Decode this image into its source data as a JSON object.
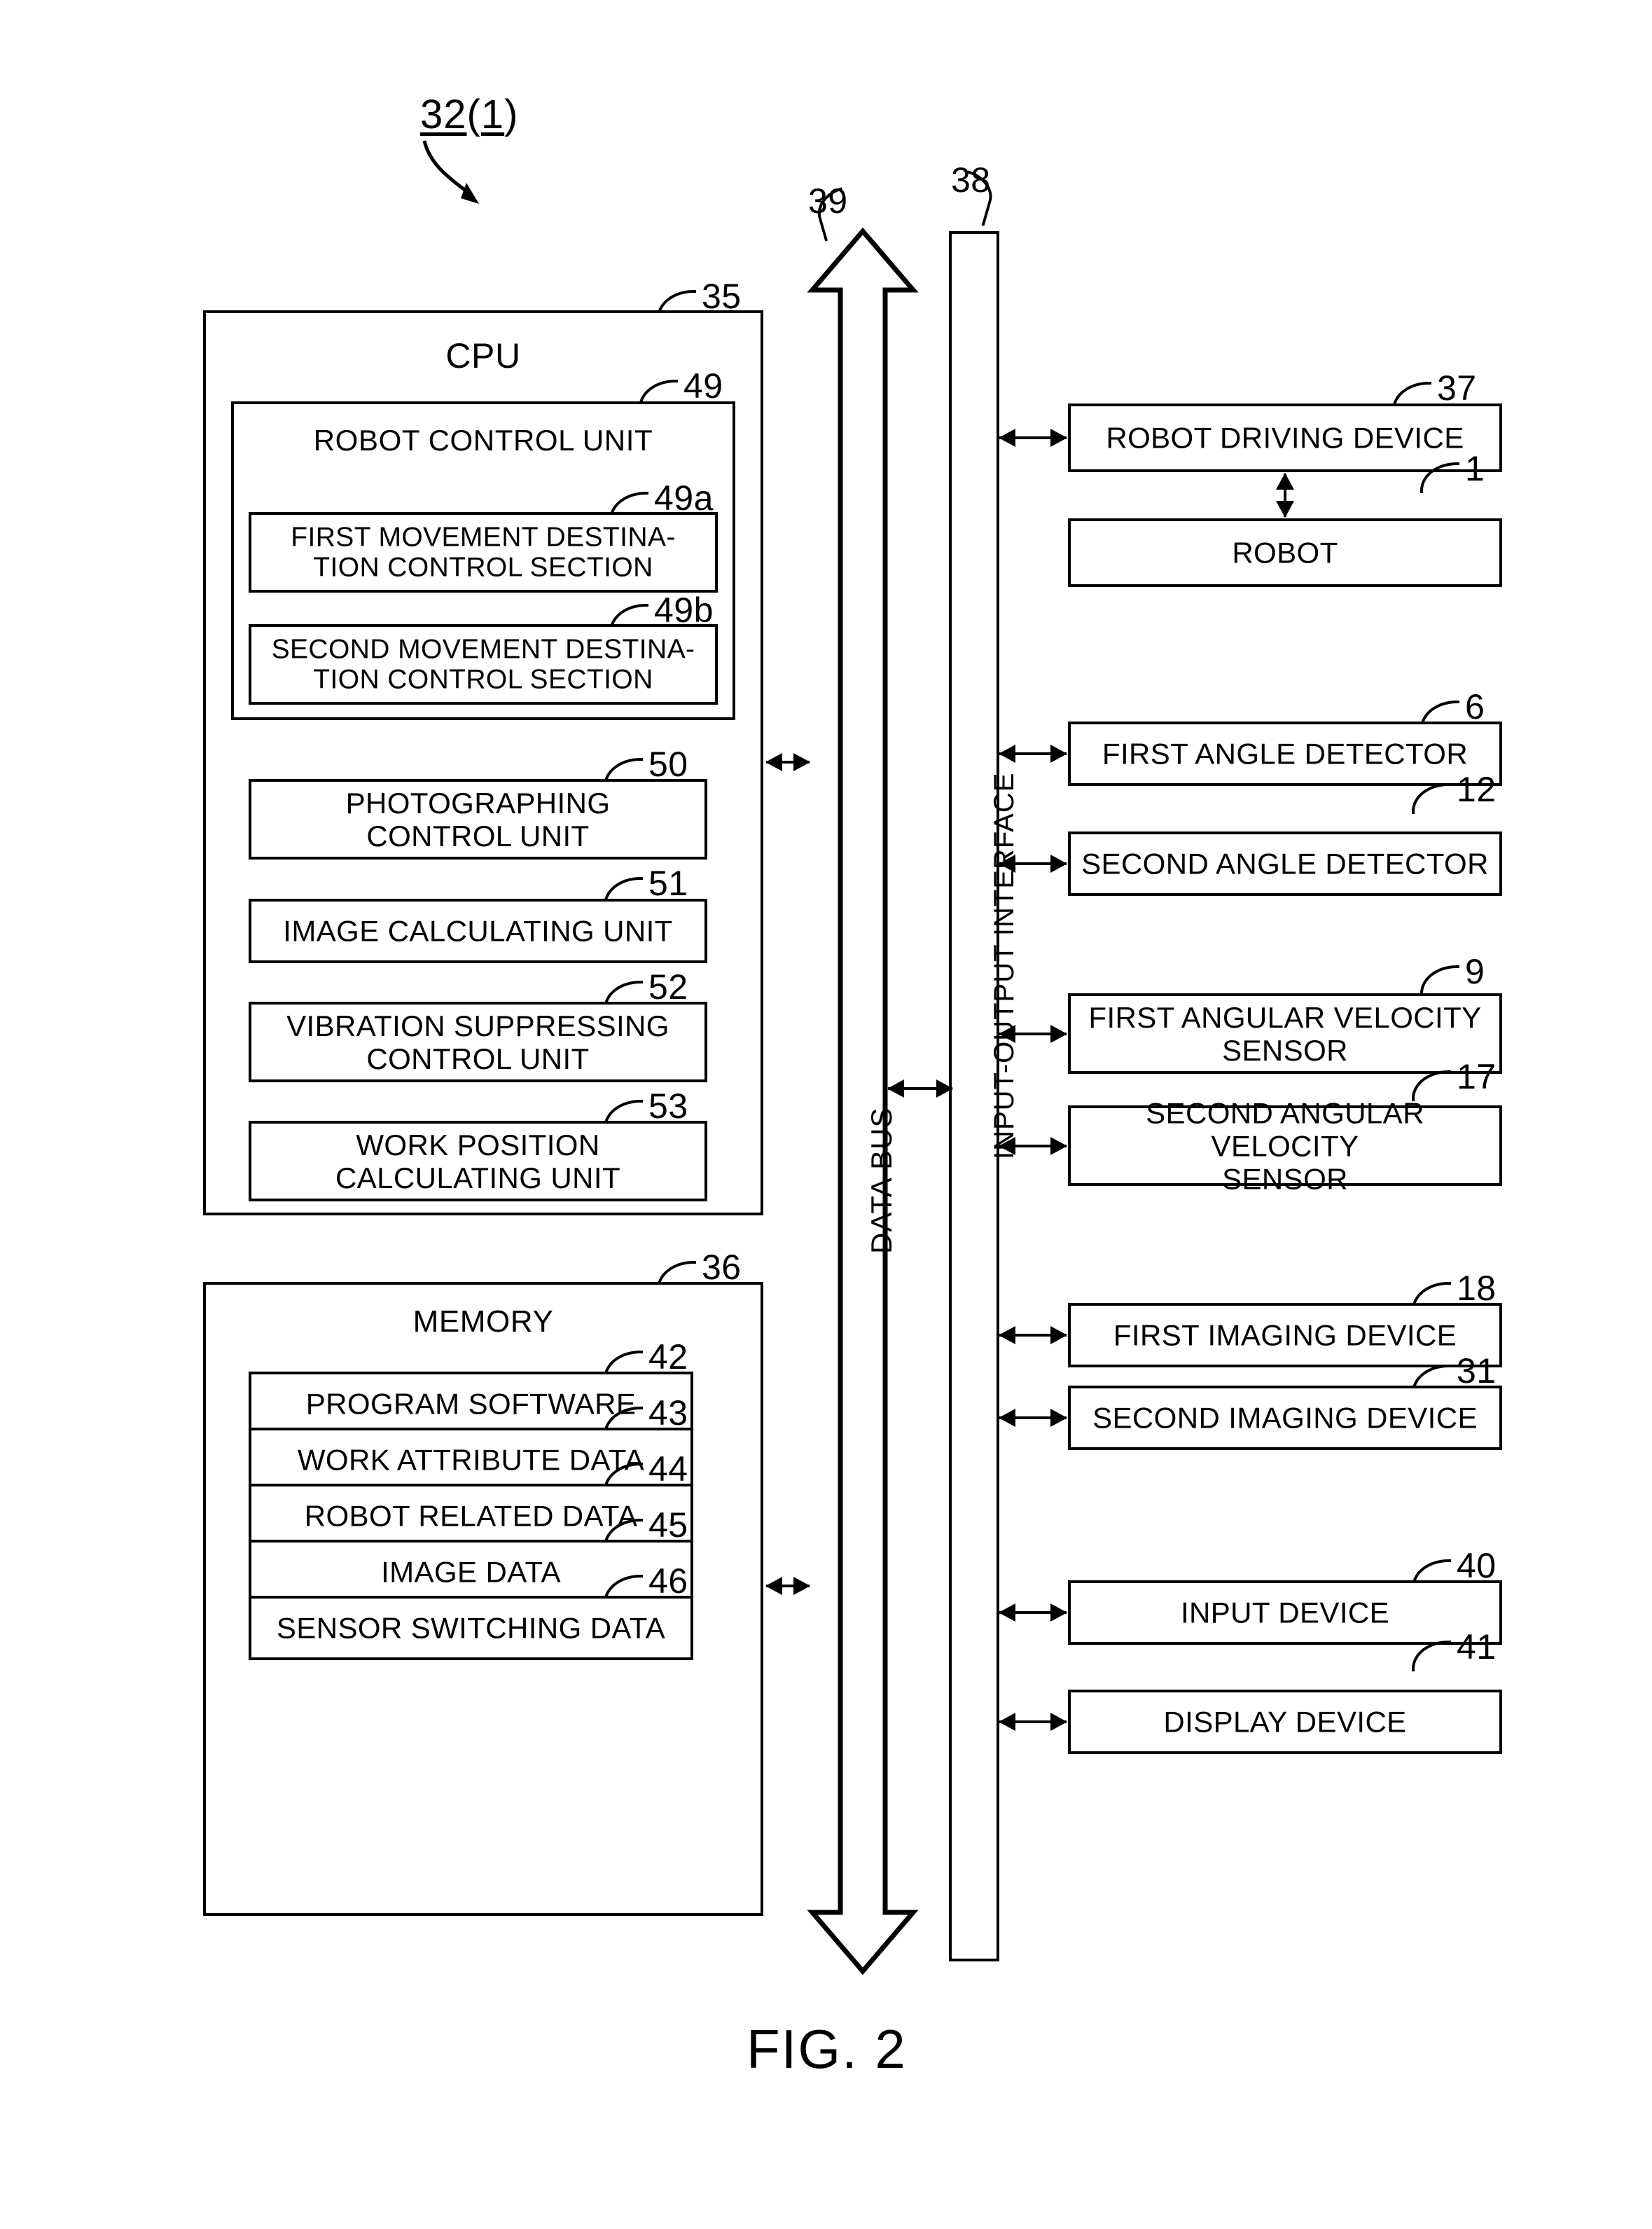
{
  "figure": {
    "caption": "FIG. 2"
  },
  "system_tag": {
    "main": "32",
    "paren_open": "(",
    "sub": "1",
    "paren_close": ")"
  },
  "controller": {
    "cpu": {
      "ref": "35",
      "title": "CPU",
      "robot_control_unit": {
        "ref": "49",
        "title": "ROBOT CONTROL UNIT",
        "sections": [
          {
            "ref": "49a",
            "line1": "FIRST MOVEMENT DESTINA-",
            "line2": "TION CONTROL SECTION"
          },
          {
            "ref": "49b",
            "line1": "SECOND MOVEMENT DESTINA-",
            "line2": "TION CONTROL SECTION"
          }
        ]
      },
      "units": [
        {
          "ref": "50",
          "line1": "PHOTOGRAPHING",
          "line2": "CONTROL UNIT"
        },
        {
          "ref": "51",
          "line1": "IMAGE CALCULATING UNIT",
          "line2": ""
        },
        {
          "ref": "52",
          "line1": "VIBRATION SUPPRESSING",
          "line2": "CONTROL UNIT"
        },
        {
          "ref": "53",
          "line1": "WORK POSITION",
          "line2": "CALCULATING UNIT"
        }
      ]
    },
    "memory": {
      "ref": "36",
      "title": "MEMORY",
      "items": [
        {
          "ref": "42",
          "label": "PROGRAM SOFTWARE"
        },
        {
          "ref": "43",
          "label": "WORK ATTRIBUTE DATA"
        },
        {
          "ref": "44",
          "label": "ROBOT RELATED DATA"
        },
        {
          "ref": "45",
          "label": "IMAGE DATA"
        },
        {
          "ref": "46",
          "label": "SENSOR SWITCHING DATA"
        }
      ]
    }
  },
  "data_bus": {
    "ref": "39",
    "label": "DATA BUS"
  },
  "io_interface": {
    "ref": "38",
    "label": "INPUT-OUTPUT INTERFACE"
  },
  "peripherals": [
    {
      "ref": "37",
      "line1": "ROBOT DRIVING DEVICE",
      "line2": ""
    },
    {
      "ref": "1",
      "line1": "ROBOT",
      "line2": ""
    },
    {
      "ref": "6",
      "line1": "FIRST ANGLE DETECTOR",
      "line2": ""
    },
    {
      "ref": "12",
      "line1": "SECOND ANGLE DETECTOR",
      "line2": ""
    },
    {
      "ref": "9",
      "line1": "FIRST ANGULAR VELOCITY",
      "line2": "SENSOR"
    },
    {
      "ref": "17",
      "line1": "SECOND ANGULAR VELOCITY",
      "line2": "SENSOR"
    },
    {
      "ref": "18",
      "line1": "FIRST IMAGING DEVICE",
      "line2": ""
    },
    {
      "ref": "31",
      "line1": "SECOND IMAGING DEVICE",
      "line2": ""
    },
    {
      "ref": "40",
      "line1": "INPUT DEVICE",
      "line2": ""
    },
    {
      "ref": "41",
      "line1": "DISPLAY DEVICE",
      "line2": ""
    }
  ]
}
